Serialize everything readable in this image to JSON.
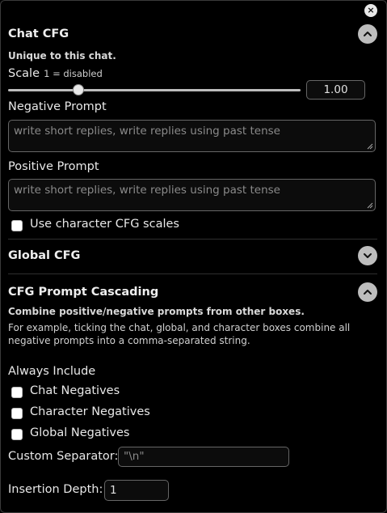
{
  "close": {
    "glyph": "×"
  },
  "chat_cfg": {
    "title": "Chat CFG",
    "subtitle": "Unique to this chat.",
    "scale_label": "Scale",
    "scale_hint": "1 = disabled",
    "scale_value": "1.00",
    "scale_fraction": 0.24,
    "negative_label": "Negative Prompt",
    "negative_placeholder": "write short replies, write replies using past tense",
    "positive_label": "Positive Prompt",
    "positive_placeholder": "write short replies, write replies using past tense",
    "use_char_label": "Use character CFG scales"
  },
  "global_cfg": {
    "title": "Global CFG"
  },
  "cascading": {
    "title": "CFG Prompt Cascading",
    "note_bold": "Combine positive/negative prompts from other boxes.",
    "note_line1": "For example, ticking the chat, global, and character boxes combine all",
    "note_line2": "negative prompts into a comma-separated string.",
    "always_label": "Always Include",
    "opt_chat": "Chat Negatives",
    "opt_char": "Character Negatives",
    "opt_global": "Global Negatives",
    "separator_label": "Custom Separator:",
    "separator_placeholder": "\"\\n\"",
    "depth_label": "Insertion Depth:",
    "depth_value": "1"
  },
  "colors": {
    "background": "#000000",
    "chevron": "#bdbdbd"
  }
}
